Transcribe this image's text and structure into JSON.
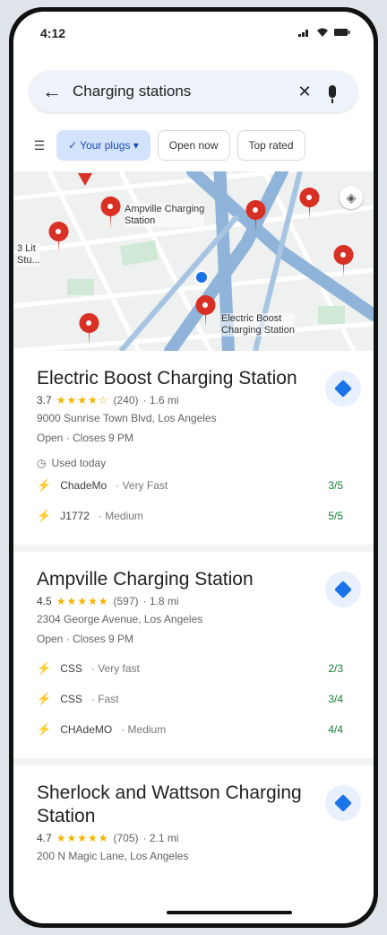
{
  "status": {
    "time": "4:12",
    "signal": "signal-icon",
    "wifi": "wifi-icon",
    "battery": "battery-icon"
  },
  "search": {
    "query": "Charging stations",
    "back": "←",
    "clear": "✕"
  },
  "chips": {
    "filter_icon": "tune-icon",
    "your_plugs": "✓ Your plugs ▾",
    "open_now": "Open now",
    "top_rated": "Top rated"
  },
  "map": {
    "labels": {
      "ampville": "Ampville Charging\nStation",
      "electric": "Electric Boost\nCharging Station",
      "left": "3 Lit\nStu..."
    }
  },
  "results": [
    {
      "name": "Electric Boost Charging Station",
      "rating": "3.7",
      "stars": "★★★★☆",
      "reviews": "(240)",
      "distance": "· 1.6 mi",
      "address": "9000 Sunrise Town Blvd, Los Angeles",
      "hours": "Open · Closes 9 PM",
      "used_today": "Used today",
      "plugs": [
        {
          "name": "ChadeMo",
          "speed": "· Very Fast",
          "avail": "3/5"
        },
        {
          "name": "J1772",
          "speed": "· Medium",
          "avail": "5/5"
        }
      ]
    },
    {
      "name": "Ampville Charging Station",
      "rating": "4.5",
      "stars": "★★★★★",
      "reviews": "(597)",
      "distance": "· 1.8 mi",
      "address": "2304 George Avenue, Los Angeles",
      "hours": "Open · Closes 9 PM",
      "plugs": [
        {
          "name": "CSS",
          "speed": "· Very fast",
          "avail": "2/3"
        },
        {
          "name": "CSS",
          "speed": "· Fast",
          "avail": "3/4"
        },
        {
          "name": "CHAdeMO",
          "speed": "· Medium",
          "avail": "4/4"
        }
      ]
    },
    {
      "name": "Sherlock and Wattson Charging Station",
      "rating": "4.7",
      "stars": "★★★★★",
      "reviews": "(705)",
      "distance": "· 2.1 mi",
      "address": "200 N Magic Lane, Los Angeles"
    }
  ]
}
